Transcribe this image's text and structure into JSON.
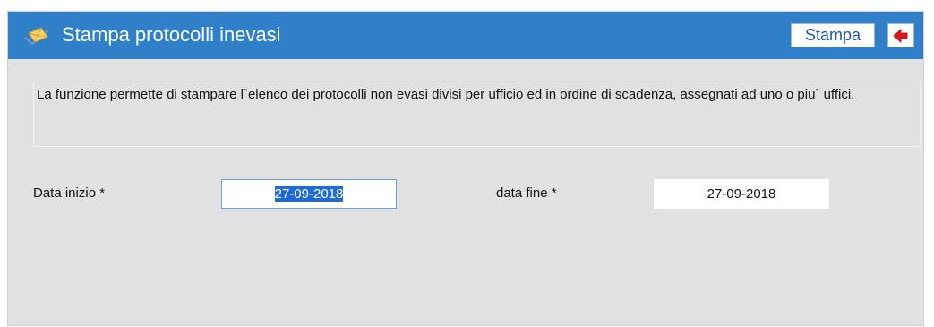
{
  "header": {
    "title": "Stampa protocolli inevasi",
    "icon": "envelope-icon",
    "print_label": "Stampa",
    "back_icon": "back-arrow-icon",
    "background_color": "#2f80c9"
  },
  "description": "La funzione permette di stampare l`elenco dei protocolli non evasi divisi per ufficio ed in ordine di scadenza, assegnati ad uno o piu` uffici.",
  "form": {
    "start_date": {
      "label": "Data inizio *",
      "value": "27-09-2018"
    },
    "end_date": {
      "label": "data fine *",
      "value": "27-09-2018"
    }
  }
}
